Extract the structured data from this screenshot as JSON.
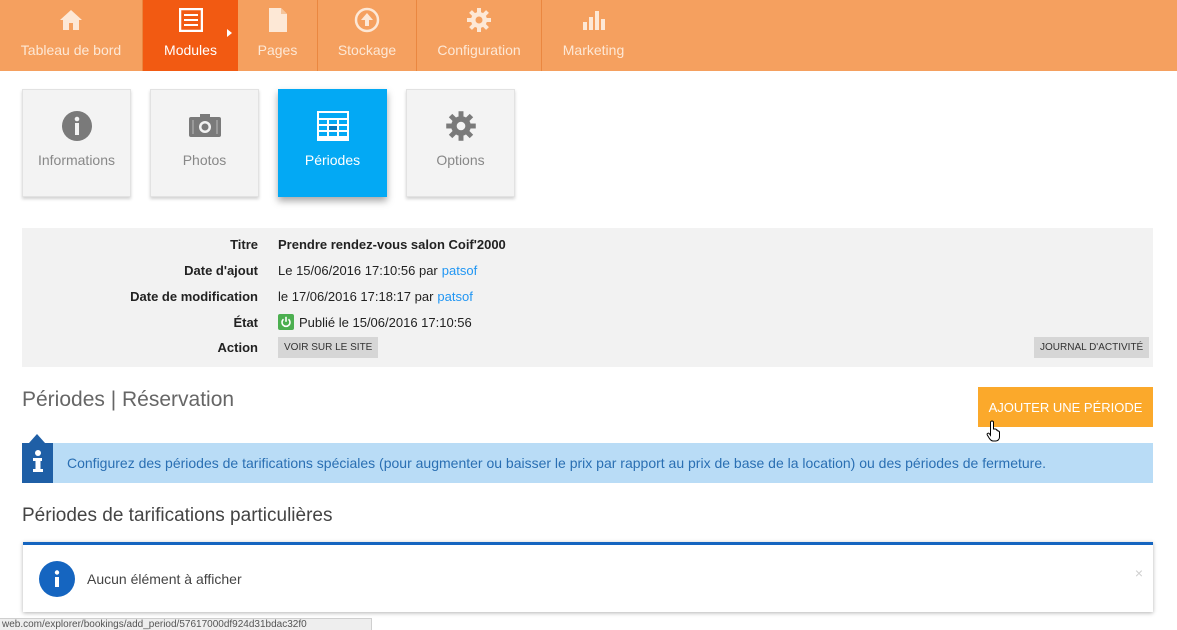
{
  "nav": {
    "items": [
      {
        "label": "Tableau de bord",
        "icon": "home-icon"
      },
      {
        "label": "Modules",
        "icon": "list-icon"
      },
      {
        "label": "Pages",
        "icon": "file-icon"
      },
      {
        "label": "Stockage",
        "icon": "upload-icon"
      },
      {
        "label": "Configuration",
        "icon": "gear-icon"
      },
      {
        "label": "Marketing",
        "icon": "bar-chart-icon"
      }
    ]
  },
  "tabs": {
    "items": [
      {
        "label": "Informations",
        "icon": "info-icon"
      },
      {
        "label": "Photos",
        "icon": "camera-icon"
      },
      {
        "label": "Périodes",
        "icon": "table-icon"
      },
      {
        "label": "Options",
        "icon": "gear-icon"
      }
    ]
  },
  "details": {
    "title_label": "Titre",
    "title_value": "Prendre rendez-vous salon Coif'2000",
    "added_label": "Date d'ajout",
    "added_value": "Le 15/06/2016 17:10:56 par",
    "added_user": "patsof",
    "modified_label": "Date de modification",
    "modified_value": "le 17/06/2016 17:18:17 par",
    "modified_user": "patsof",
    "state_label": "État",
    "state_value": "Publié le 15/06/2016 17:10:56",
    "action_label": "Action",
    "view_site_button": "VOIR SUR LE SITE",
    "journal_button": "JOURNAL D'ACTIVITÉ"
  },
  "section": {
    "title": "Périodes | Réservation",
    "add_button": "AJOUTER UNE PÉRIODE"
  },
  "alert": {
    "text": "Configurez des périodes de tarifications spéciales (pour augmenter ou baisser le prix par rapport au prix de base de la location) ou des périodes de fermeture."
  },
  "special": {
    "title": "Périodes de tarifications particulières",
    "empty_text": "Aucun élément à afficher",
    "close": "×"
  },
  "statusbar": {
    "url": "web.com/explorer/bookings/add_period/57617000df924d31bdac32f0"
  },
  "colors": {
    "nav_bg": "#f5a05f",
    "nav_active": "#f25a12",
    "tab_active": "#03a9f4",
    "add_button": "#fba92b",
    "info_dark": "#1f5fa6",
    "info_light": "#b9dcf6",
    "link": "#2196f3",
    "published": "#4caf50"
  }
}
